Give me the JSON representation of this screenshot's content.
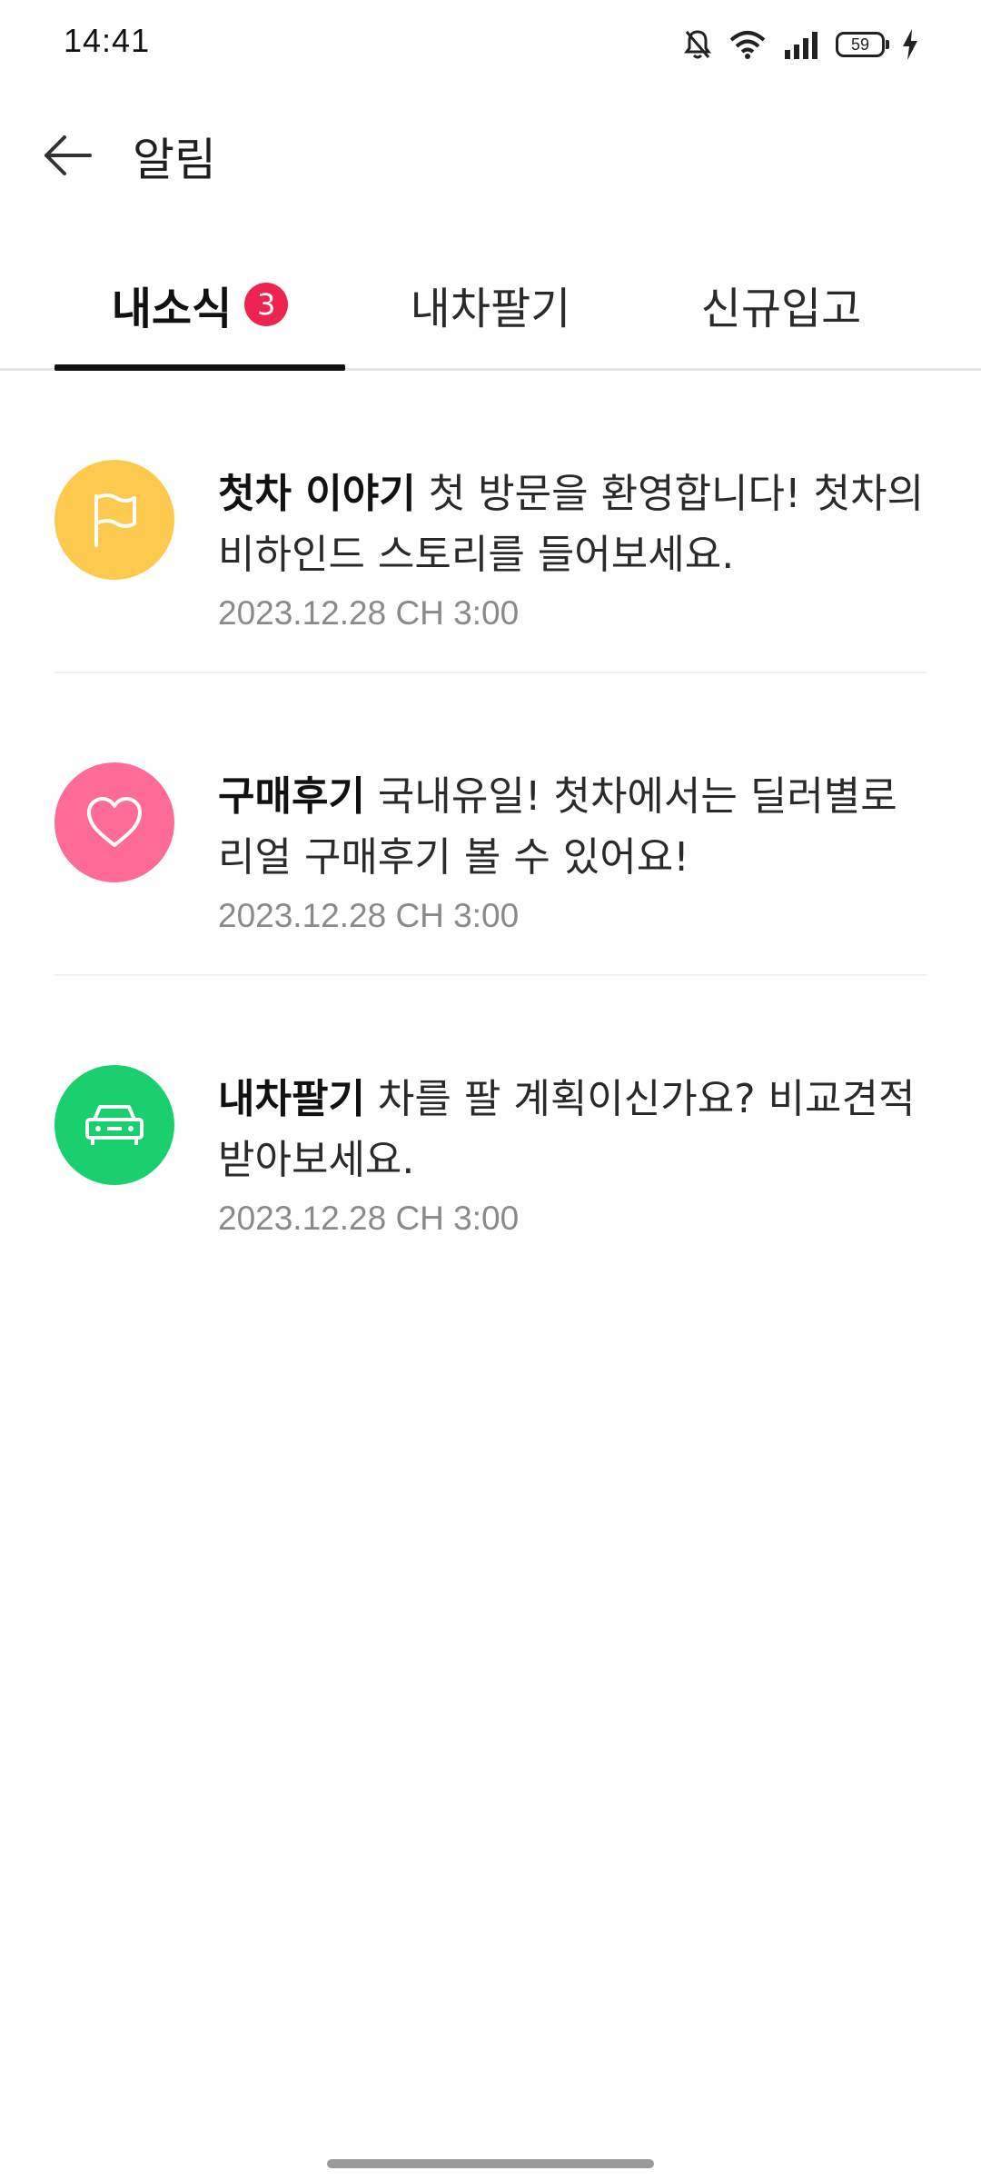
{
  "status_bar": {
    "time": "14:41",
    "battery": "59",
    "icons": [
      "bell-off-icon",
      "wifi-icon",
      "signal-icon",
      "battery-icon",
      "charging-icon"
    ]
  },
  "header": {
    "title": "알림",
    "back_icon": "arrow-left-icon"
  },
  "tabs": [
    {
      "label": "내소식",
      "badge": "3",
      "active": true
    },
    {
      "label": "내차팔기",
      "active": false
    },
    {
      "label": "신규입고",
      "active": false
    }
  ],
  "notifications": [
    {
      "category": "첫차 이야기",
      "message": "첫 방문을 환영합니다! 첫차의 비하인드 스토리를 들어보세요.",
      "date": "2023.12.28 CH 3:00",
      "icon": "flag-icon",
      "color": "#fdca4f"
    },
    {
      "category": "구매후기",
      "message": "국내유일! 첫차에서는 딜러별로 리얼 구매후기 볼 수 있어요!",
      "date": "2023.12.28 CH 3:00",
      "icon": "heart-icon",
      "color": "#fd6b96"
    },
    {
      "category": "내차팔기",
      "message": "차를 팔 계획이신가요? 비교견적 받아보세요.",
      "date": "2023.12.28 CH 3:00",
      "icon": "car-icon",
      "color": "#1ad06e"
    }
  ],
  "colors": {
    "badge": "#ee2450",
    "active_tab_indicator": "#111111",
    "date_text": "#8a8a8a"
  }
}
